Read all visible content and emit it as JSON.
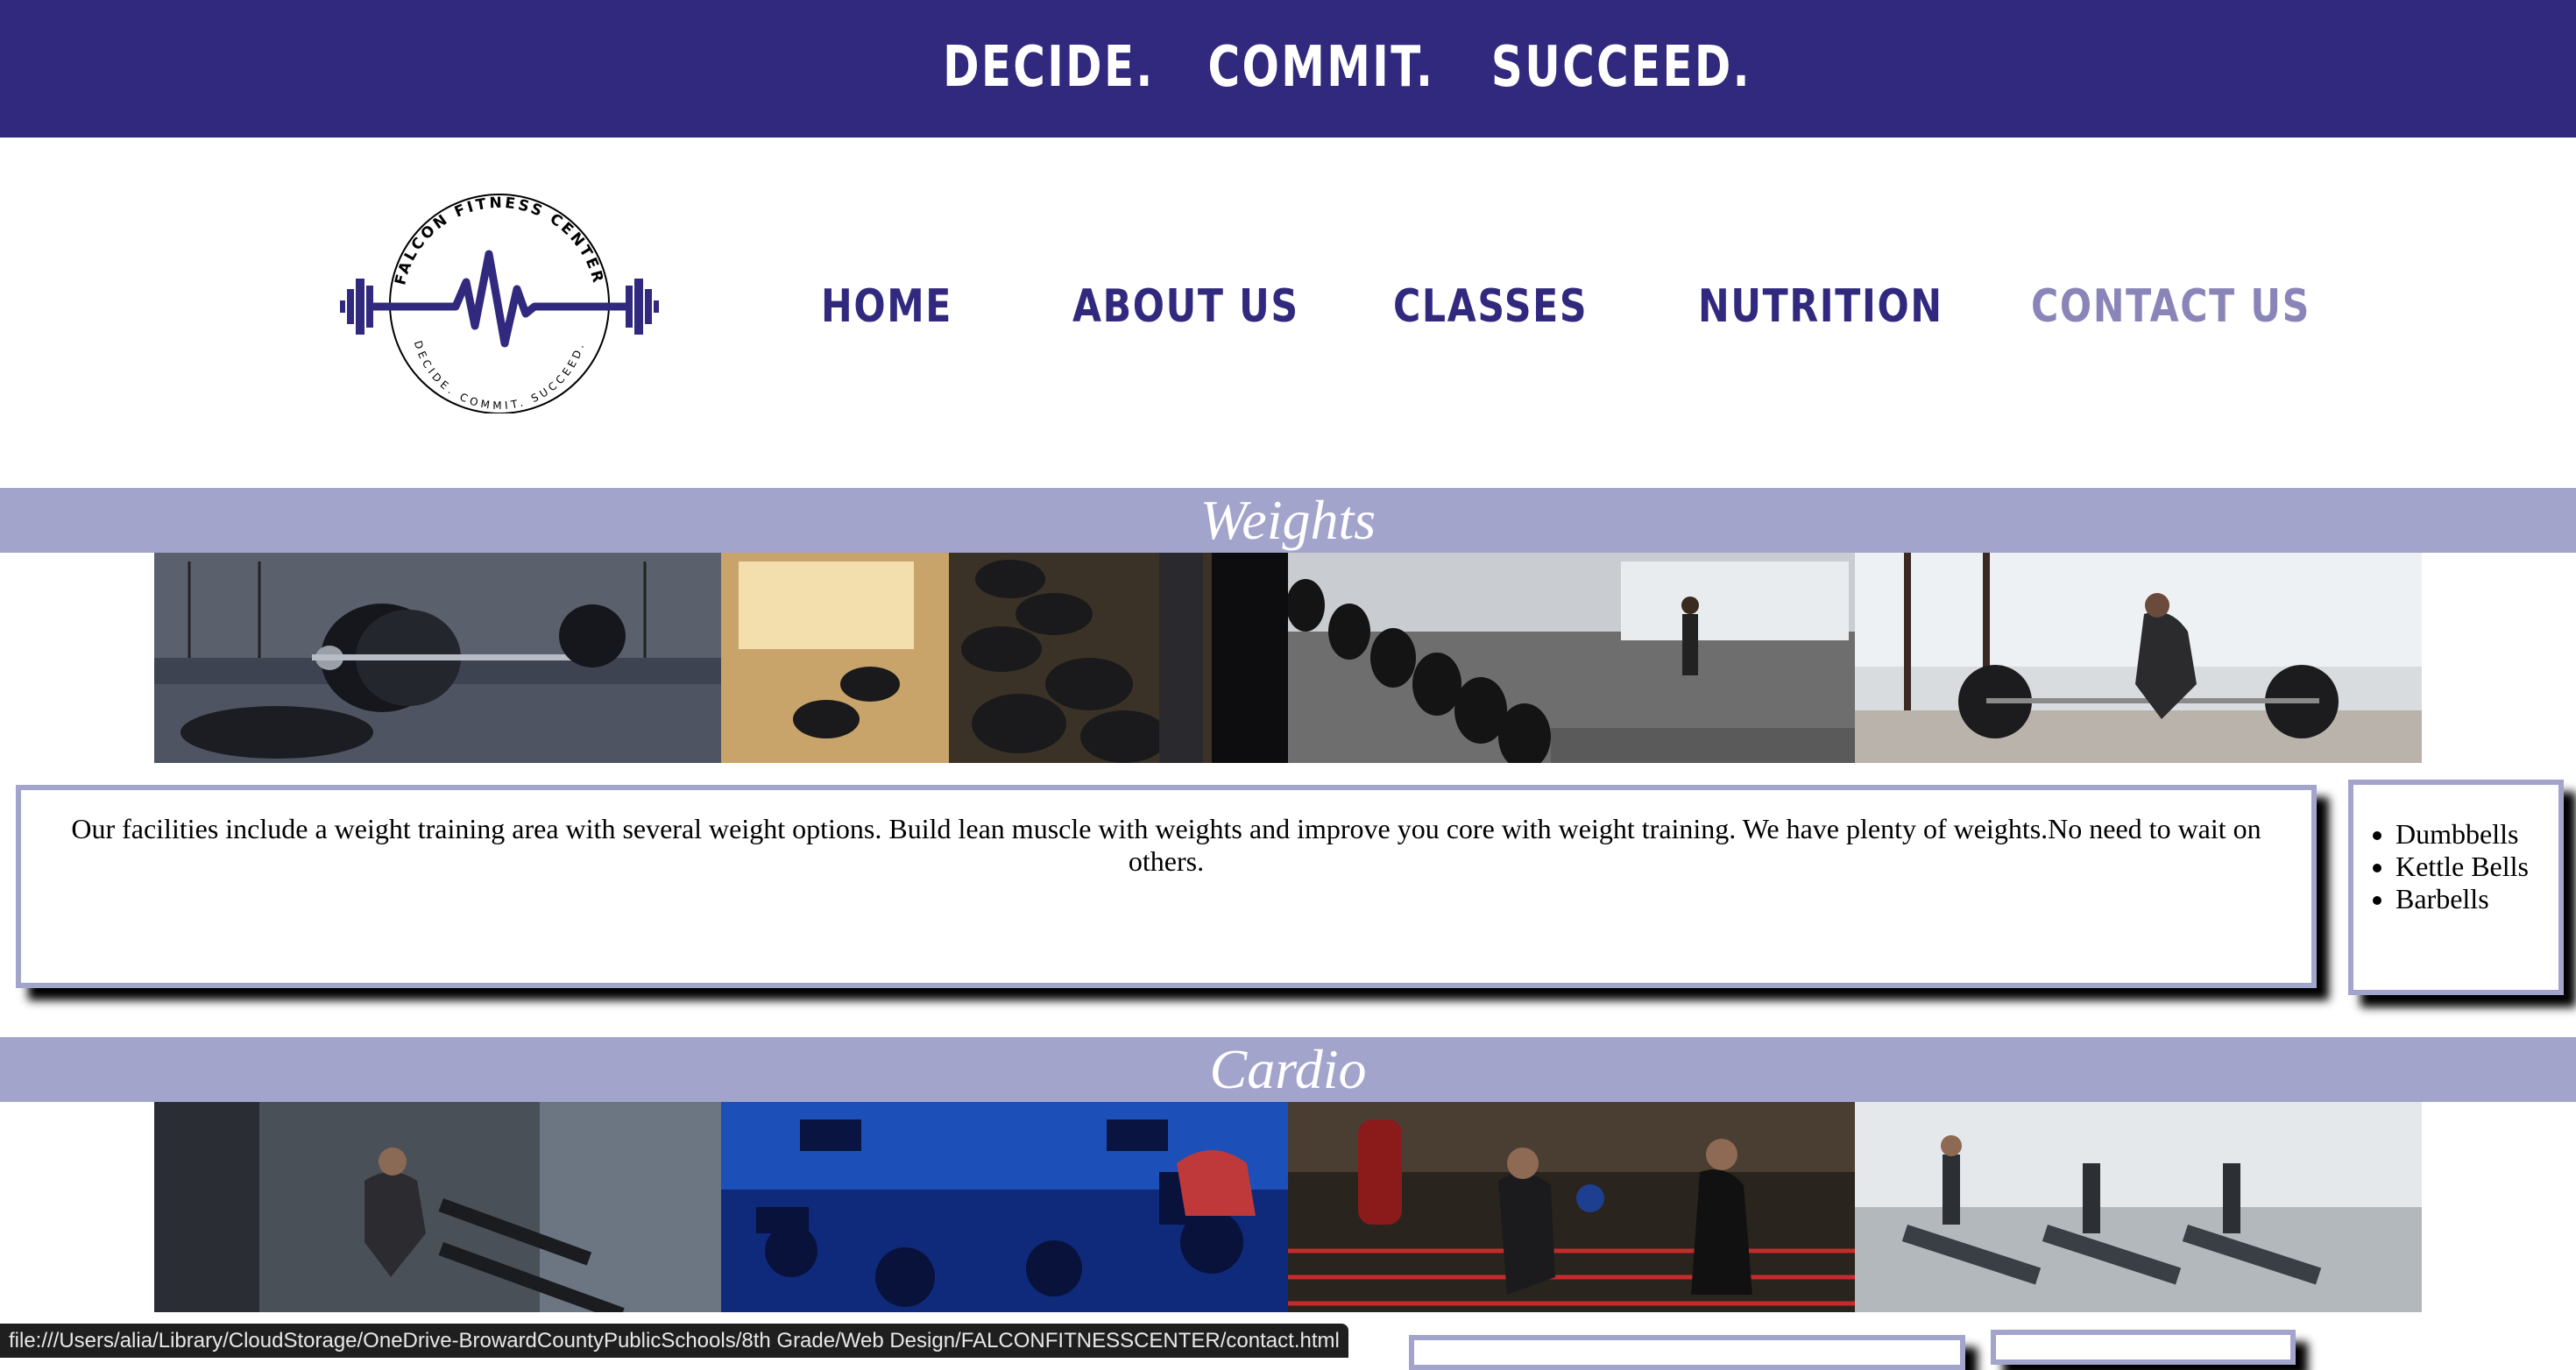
{
  "banner": {
    "tag1": "DECIDE.",
    "tag2": "COMMIT.",
    "tag3": "SUCCEED."
  },
  "logo": {
    "top_text": "FALCON FITNESS CENTER",
    "bottom_text": "DECIDE. COMMIT. SUCCEED.",
    "icon": "barbell-heartbeat-icon"
  },
  "nav": {
    "home": "HOME",
    "about": "ABOUT US",
    "classes": "CLASSES",
    "nutrition": "NUTRITION",
    "contact": "CONTACT US",
    "active": "contact"
  },
  "weights": {
    "heading": "Weights",
    "photos": [
      "barbell plates on gym floor",
      "dumbbell rack in sunlight",
      "rows of dumbbells in gym",
      "woman lifting barbell"
    ],
    "description": "Our facilities include a weight training area with several weight options. Build lean muscle with weights and improve you core with weight training. We have plenty of weights.No need to wait on others.",
    "equipment": [
      "Dumbbells",
      "Kettle Bells",
      "Barbells"
    ]
  },
  "cardio": {
    "heading": "Cardio",
    "photos": [
      "woman running on treadmill",
      "indoor cycling class",
      "boxing training",
      "treadmill row"
    ]
  },
  "status_url": "file:///Users/alia/Library/CloudStorage/OneDrive-BrowardCountyPublicSchools/8th Grade/Web Design/FALCONFITNESSCENTER/contact.html",
  "colors": {
    "primary": "#30297e",
    "band": "#a2a4cc",
    "active_nav": "#8a85b8"
  }
}
